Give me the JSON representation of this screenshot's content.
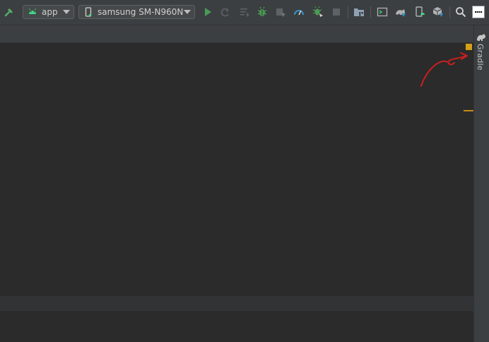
{
  "toolbar": {
    "module_selector": {
      "label": "app",
      "icon": "android-icon"
    },
    "device_selector": {
      "label": "samsung SM-N960N",
      "icon": "phone-icon"
    },
    "icons": [
      "hammer-icon",
      "run-icon",
      "apply-changes-icon",
      "apply-code-changes-icon",
      "debug-icon",
      "attach-debugger-icon",
      "profile-icon",
      "attach-debug-icon",
      "stop-icon",
      "project-structure-icon",
      "terminal-icon",
      "sync-gradle-icon",
      "avd-manager-icon",
      "sdk-manager-icon",
      "search-icon",
      "user-avatar"
    ]
  },
  "right_tool_window": {
    "gradle_label": "Gradle"
  },
  "annotation": {
    "type": "red-arrow",
    "points_to": "Gradle"
  },
  "colors": {
    "toolbar_bg": "#3c3f41",
    "editor_bg": "#2b2b2b",
    "run_green": "#499c54",
    "android_green": "#3ddc84",
    "marker_orange": "#d4a017",
    "annotation_red": "#cc1f1f"
  }
}
